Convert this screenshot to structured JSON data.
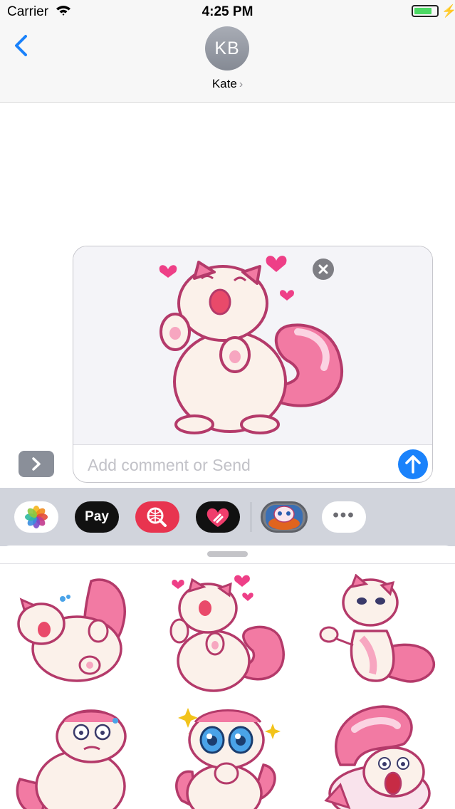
{
  "status_bar": {
    "carrier": "Carrier",
    "time": "4:25 PM",
    "battery_level": 0.8
  },
  "header": {
    "avatar_initials": "KB",
    "contact_name": "Kate",
    "contact_chevron": "›"
  },
  "compose": {
    "placeholder": "Add comment or Send"
  },
  "app_drawer": {
    "apps": [
      {
        "name": "Photos",
        "icon": "photos-icon"
      },
      {
        "name": "Apple Pay",
        "label": "Pay",
        "icon": "apple-icon"
      },
      {
        "name": "Search images",
        "icon": "search-globe-icon"
      },
      {
        "name": "Digital Touch",
        "icon": "heart-hand-icon"
      },
      {
        "name": "Sticker pack",
        "icon": "cat-sticker-icon"
      },
      {
        "name": "More",
        "label": "•••",
        "icon": "more-icon"
      }
    ]
  },
  "stickers": [
    {
      "name": "cat-rolling-laughing"
    },
    {
      "name": "cat-hearts-happy"
    },
    {
      "name": "cat-waving"
    },
    {
      "name": "cat-worried"
    },
    {
      "name": "cat-big-eyes"
    },
    {
      "name": "cat-screaming"
    }
  ],
  "colors": {
    "accent": "#1a82fb",
    "cat_pink": "#f27aa3",
    "cat_outline": "#b43a6a",
    "cat_body": "#fbf1ea",
    "battery_green": "#4cd964"
  }
}
